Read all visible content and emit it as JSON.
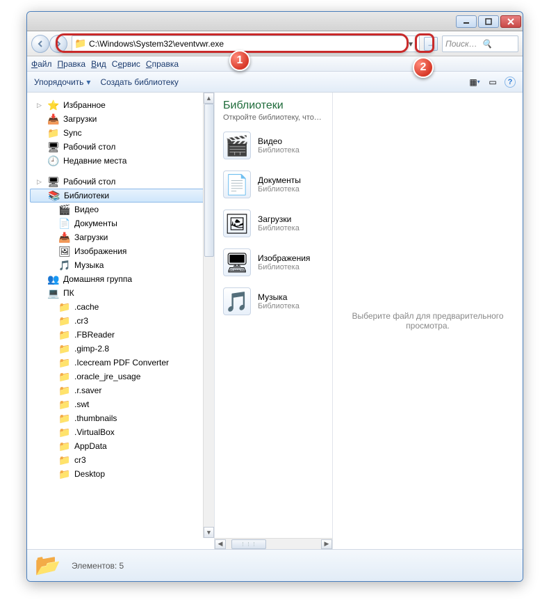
{
  "address_bar": {
    "value": "C:\\Windows\\System32\\eventvwr.exe"
  },
  "search": {
    "placeholder": "Поиск: Биб…"
  },
  "menu": {
    "file": "Файл",
    "edit": "Правка",
    "view": "Вид",
    "tools": "Сервис",
    "help": "Справка"
  },
  "toolbar": {
    "organize": "Упорядочить",
    "new_library": "Создать библиотеку"
  },
  "sidebar": {
    "favorites": "Избранное",
    "fav_items": [
      "Загрузки",
      "Sync",
      "Рабочий стол",
      "Недавние места"
    ],
    "desktop": "Рабочий стол",
    "libraries": "Библиотеки",
    "lib_items": [
      "Видео",
      "Документы",
      "Загрузки",
      "Изображения",
      "Музыка"
    ],
    "homegroup": "Домашняя группа",
    "pc": "ПК",
    "pc_items": [
      ".cache",
      ".cr3",
      ".FBReader",
      ".gimp-2.8",
      ".Icecream PDF Converter",
      ".oracle_jre_usage",
      ".r.saver",
      ".swt",
      ".thumbnails",
      ".VirtualBox",
      "AppData",
      "cr3",
      "Desktop"
    ]
  },
  "main": {
    "title": "Библиотеки",
    "subtitle": "Откройте библиотеку, что…",
    "items": [
      {
        "name": "Видео",
        "type": "Библиотека",
        "icon": "🎬"
      },
      {
        "name": "Документы",
        "type": "Библиотека",
        "icon": "📄"
      },
      {
        "name": "Загрузки",
        "type": "Библиотека",
        "icon": "🖼"
      },
      {
        "name": "Изображения",
        "type": "Библиотека",
        "icon": "🖥"
      },
      {
        "name": "Музыка",
        "type": "Библиотека",
        "icon": "🎵"
      }
    ]
  },
  "preview": {
    "empty": "Выберите файл для предварительного просмотра."
  },
  "status": {
    "count_label": "Элементов: 5"
  },
  "callouts": {
    "one": "1",
    "two": "2"
  }
}
